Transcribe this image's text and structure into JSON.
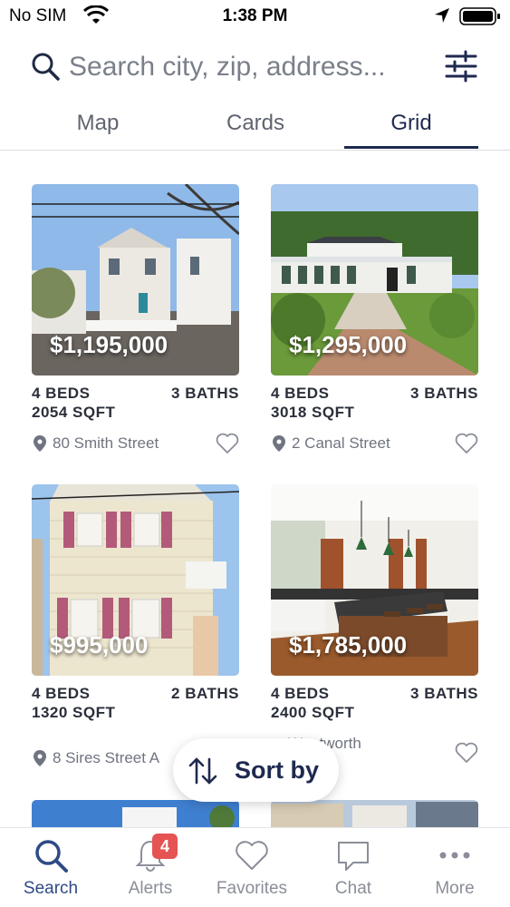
{
  "status_bar": {
    "carrier": "No SIM",
    "time": "1:38 PM"
  },
  "search": {
    "placeholder": "Search city, zip, address..."
  },
  "tabs": [
    {
      "label": "Map",
      "active": false
    },
    {
      "label": "Cards",
      "active": false
    },
    {
      "label": "Grid",
      "active": true
    }
  ],
  "listings": [
    {
      "price": "$1,195,000",
      "beds": "4 BEDS",
      "baths": "3 BATHS",
      "sqft": "2054 SQFT",
      "address": "80 Smith Street"
    },
    {
      "price": "$1,295,000",
      "beds": "4 BEDS",
      "baths": "3 BATHS",
      "sqft": "3018 SQFT",
      "address": "2 Canal Street"
    },
    {
      "price": "$995,000",
      "beds": "4 BEDS",
      "baths": "2 BATHS",
      "sqft": "1320 SQFT",
      "address": "8 Sires Street A"
    },
    {
      "price": "$1,785,000",
      "beds": "4 BEDS",
      "baths": "3 BATHS",
      "sqft": "2400 SQFT",
      "address": "... Wentworth"
    }
  ],
  "sort": {
    "label": "Sort by"
  },
  "bottom_nav": [
    {
      "label": "Search",
      "icon": "search-icon",
      "active": true
    },
    {
      "label": "Alerts",
      "icon": "bell-icon",
      "badge": "4"
    },
    {
      "label": "Favorites",
      "icon": "heart-icon"
    },
    {
      "label": "Chat",
      "icon": "chat-icon"
    },
    {
      "label": "More",
      "icon": "more-icon"
    }
  ],
  "colors": {
    "accent": "#1f2a50",
    "badge": "#e55353",
    "active_nav": "#2e4a86"
  }
}
